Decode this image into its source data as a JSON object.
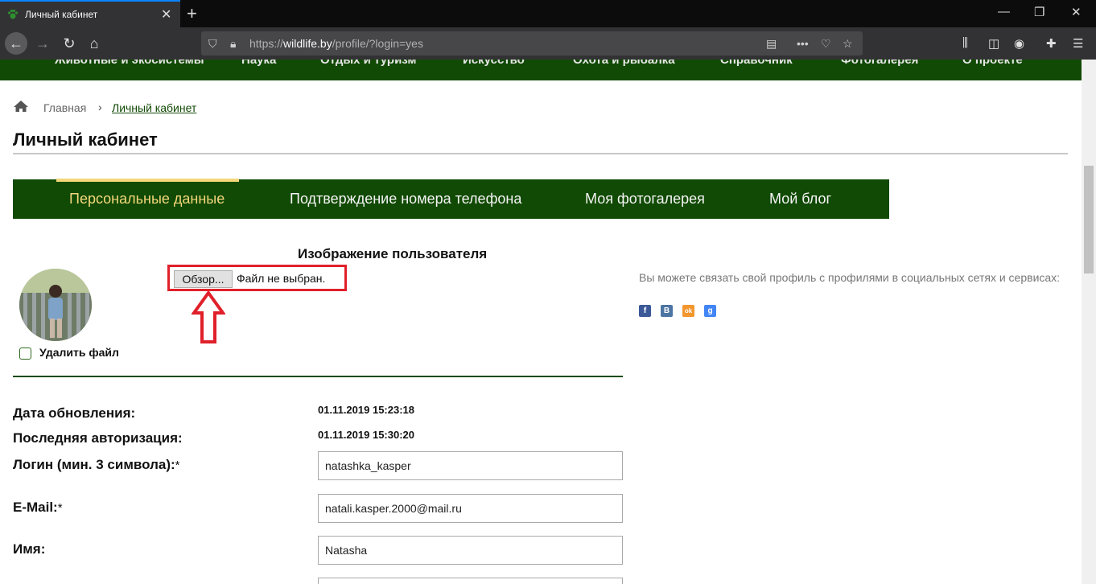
{
  "browser": {
    "tab_title": "Личный кабинет",
    "url_prefix": "https://",
    "url_host": "wildlife.by",
    "url_path": "/profile/?login=yes",
    "accent": "#0a84ff"
  },
  "site": {
    "menu_color": "#114a04",
    "top_menu": [
      "Животные и экосистемы",
      "Наука",
      "Отдых и туризм",
      "Искусство",
      "Охота и рыбалка",
      "Справочник",
      "Фотогалерея",
      "О проекте"
    ]
  },
  "breadcrumb": {
    "home": "Главная",
    "separator": "›",
    "current": "Личный кабинет"
  },
  "page_title": "Личный кабинет",
  "profile_tabs": [
    {
      "label": "Персональные данные",
      "active": true
    },
    {
      "label": "Подтверждение номера телефона",
      "active": false
    },
    {
      "label": "Моя фотогалерея",
      "active": false
    },
    {
      "label": "Мой блог",
      "active": false
    }
  ],
  "image_section": {
    "title": "Изображение пользователя",
    "browse_label": "Обзор...",
    "no_file_text": "Файл не выбран.",
    "delete_label": "Удалить файл",
    "highlight_color": "#e0202a"
  },
  "social": {
    "text": "Вы можете связать свой профиль с профилями в социальных сетях и сервисах:",
    "icons": [
      {
        "name": "facebook-icon",
        "glyph": "f",
        "color": "#3b5998"
      },
      {
        "name": "vkontakte-icon",
        "glyph": "В",
        "color": "#4c75a3"
      },
      {
        "name": "odnoklassniki-icon",
        "glyph": "ok",
        "color": "#f2962e"
      },
      {
        "name": "google-icon",
        "glyph": "g",
        "color": "#4285f4"
      }
    ]
  },
  "form": {
    "updated_label": "Дата обновления:",
    "updated_value": "01.11.2019 15:23:18",
    "last_auth_label": "Последняя авторизация:",
    "last_auth_value": "01.11.2019 15:30:20",
    "login_label": "Логин (мин. 3 символа):",
    "login_value": "natashka_kasper",
    "email_label": "E-Mail:",
    "email_value": "natali.kasper.2000@mail.ru",
    "name_label": "Имя:",
    "name_value": "Natasha",
    "required_mark": "*"
  }
}
